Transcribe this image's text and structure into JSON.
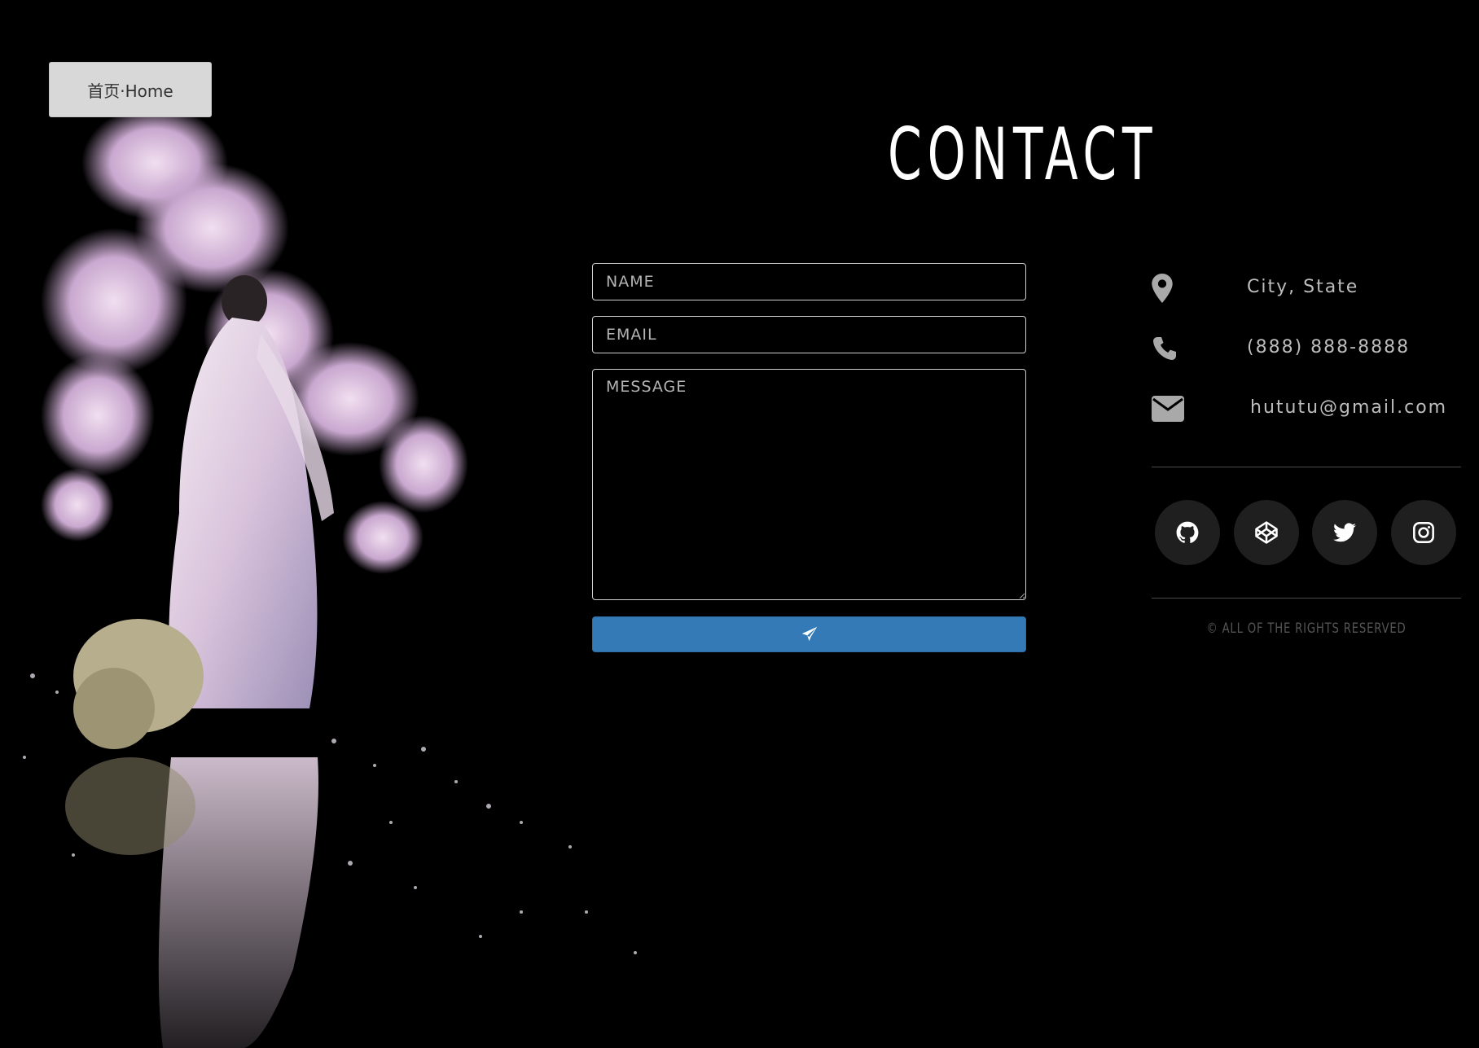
{
  "nav": {
    "home_label": "首页·Home"
  },
  "header": {
    "title": "CONTACT"
  },
  "form": {
    "name_placeholder": "NAME",
    "email_placeholder": "EMAIL",
    "message_placeholder": "MESSAGE",
    "send_icon": "paper-plane-icon",
    "send_color": "#337ab7"
  },
  "info": {
    "location": {
      "icon": "map-marker-icon",
      "text": "City, State"
    },
    "phone": {
      "icon": "phone-icon",
      "text": "(888) 888-8888"
    },
    "email": {
      "icon": "envelope-icon",
      "text": "hututu@gmail.com"
    }
  },
  "social": [
    {
      "icon": "github-icon"
    },
    {
      "icon": "codepen-icon"
    },
    {
      "icon": "twitter-icon"
    },
    {
      "icon": "instagram-icon"
    }
  ],
  "footer": {
    "copyright": "© ALL OF THE RIGHTS RESERVED"
  },
  "colors": {
    "background": "#000000",
    "accent": "#337ab7",
    "muted_text": "#bdbdbd"
  }
}
